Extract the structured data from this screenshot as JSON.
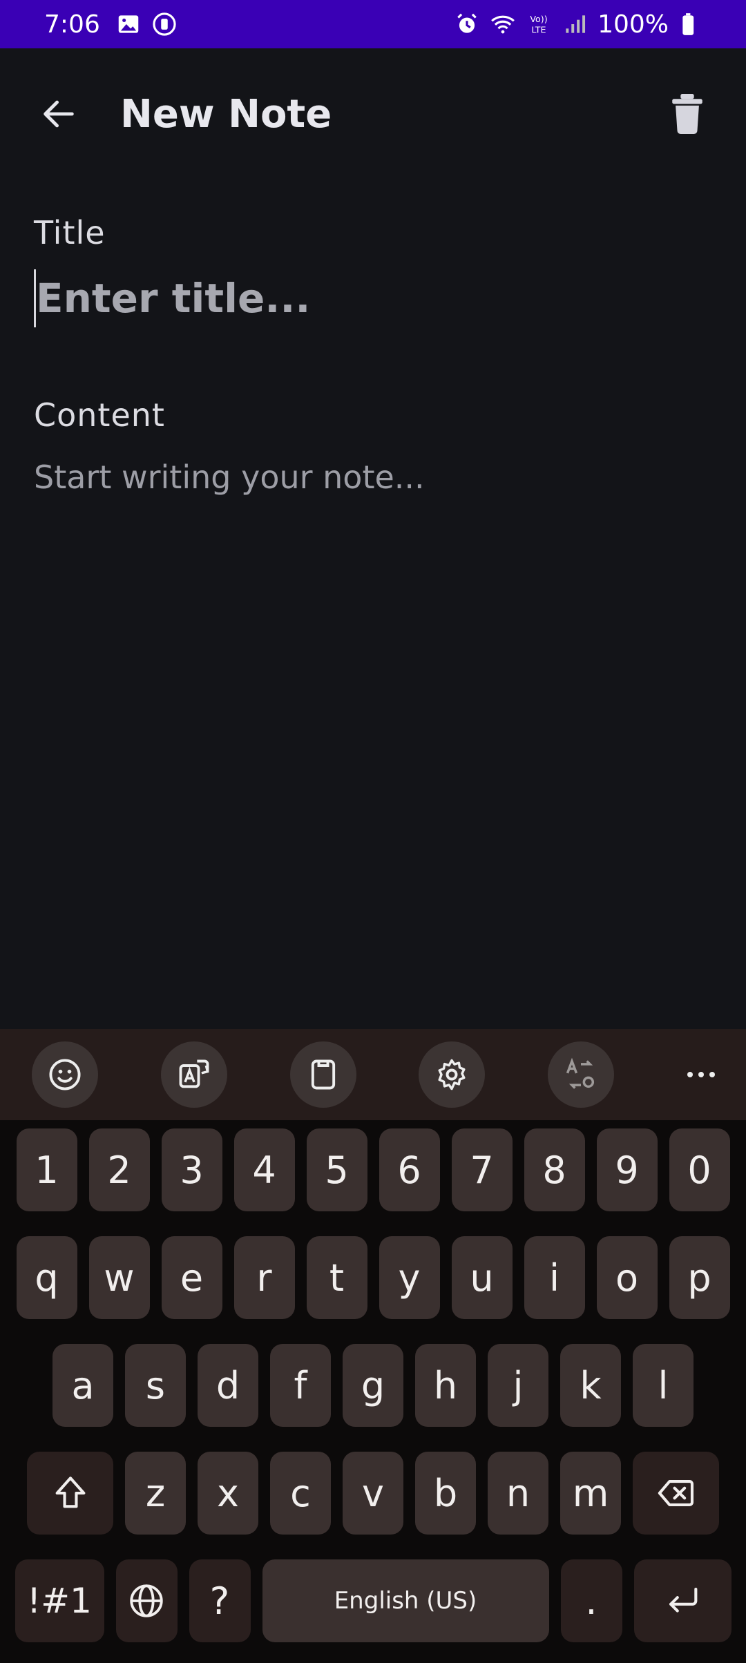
{
  "status_bar": {
    "time": "7:06",
    "battery": "100%",
    "left_icons": [
      "image-icon",
      "sync-circle-icon"
    ],
    "right_icons": [
      "alarm-icon",
      "wifi-icon",
      "volte-icon",
      "signal-icon",
      "battery-icon"
    ],
    "volte_text": "Vo)) LTE"
  },
  "app_bar": {
    "title": "New Note"
  },
  "form": {
    "title_label": "Title",
    "title_placeholder": "Enter title...",
    "title_value": "",
    "content_label": "Content",
    "content_placeholder": "Start writing your note...",
    "content_value": ""
  },
  "keyboard": {
    "toolbar": [
      "emoji-icon",
      "translate-icon",
      "clipboard-icon",
      "settings-icon",
      "text-switch-icon",
      "more-icon"
    ],
    "number_row": [
      "1",
      "2",
      "3",
      "4",
      "5",
      "6",
      "7",
      "8",
      "9",
      "0"
    ],
    "row1": [
      "q",
      "w",
      "e",
      "r",
      "t",
      "y",
      "u",
      "i",
      "o",
      "p"
    ],
    "row2": [
      "a",
      "s",
      "d",
      "f",
      "g",
      "h",
      "j",
      "k",
      "l"
    ],
    "row3": [
      "z",
      "x",
      "c",
      "v",
      "b",
      "n",
      "m"
    ],
    "symbols_label": "!#1",
    "question_label": "?",
    "space_label": "English (US)",
    "period_label": "."
  },
  "colors": {
    "status_bar": "#3a00b5",
    "background": "#131418",
    "keyboard_bg": "#0c0a0a",
    "key_bg": "#3a302f",
    "toolbar_bg": "#261c1b"
  }
}
